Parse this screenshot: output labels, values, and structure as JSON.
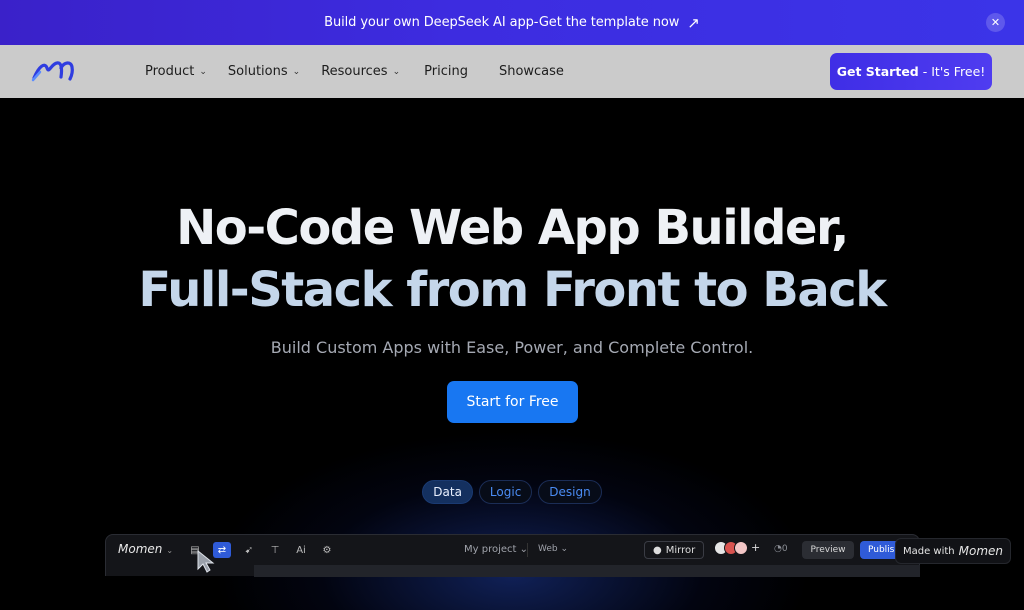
{
  "banner": {
    "text": "Build your own DeepSeek AI app-Get the template now",
    "arrow_icon": "arrow-up-right-icon",
    "close_icon": "close-icon"
  },
  "nav": {
    "logo": "momen-logo",
    "items": [
      {
        "label": "Product",
        "has_dropdown": true
      },
      {
        "label": "Solutions",
        "has_dropdown": true
      },
      {
        "label": "Resources",
        "has_dropdown": true
      },
      {
        "label": "Pricing",
        "has_dropdown": false
      },
      {
        "label": "Showcase",
        "has_dropdown": false
      }
    ],
    "cta_strong": "Get Started",
    "cta_rest": "- It's Free!"
  },
  "hero": {
    "title_line1": "No-Code Web App Builder,",
    "title_line2": "Full-Stack from Front to Back",
    "subtitle": "Build Custom Apps with Ease, Power, and Complete Control.",
    "cta": "Start for Free"
  },
  "tabs": [
    {
      "label": "Data",
      "active": true
    },
    {
      "label": "Logic",
      "active": false
    },
    {
      "label": "Design",
      "active": false
    }
  ],
  "app_preview": {
    "logo_text": "Momen",
    "project": "My project",
    "platform": "Web",
    "mirror": "Mirror",
    "online_count": "0",
    "preview": "Preview",
    "publish": "Publish"
  },
  "made_with": {
    "prefix": "Made with",
    "brand": "Momen"
  },
  "colors": {
    "banner": "#3a21c9",
    "cta_nav": "#3f2ee6",
    "hero_cta": "#1877f2",
    "tab_active": "#14305f"
  }
}
